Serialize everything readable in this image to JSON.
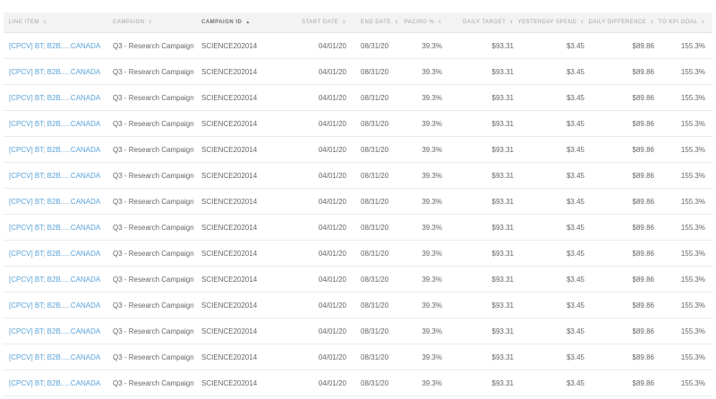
{
  "columns": [
    {
      "label": "Line Item",
      "sort_icon": "sort-icon"
    },
    {
      "label": "Campaign",
      "sort_icon": "sort-icon"
    },
    {
      "label": "Campaign ID",
      "sort_icon": "sort-asc-icon",
      "active": true
    },
    {
      "label": "Start Date",
      "sort_icon": "sort-icon"
    },
    {
      "label": "End Date",
      "sort_icon": "sort-icon"
    },
    {
      "label": "Pacing %",
      "sort_icon": "sort-icon"
    },
    {
      "label": "Daily Target",
      "sort_icon": "sort-icon"
    },
    {
      "label": "Yesterday Spend",
      "sort_icon": "sort-icon"
    },
    {
      "label": "Daily Difference",
      "sort_icon": "sort-icon"
    },
    {
      "label": "To KPI Goal",
      "sort_icon": "sort-icon"
    }
  ],
  "sort_glyphs": {
    "default": "⬍",
    "asc": "▲"
  },
  "colors": {
    "link": "#5aa3d8",
    "header_bg": "#f3f3f3",
    "text": "#666666"
  },
  "rows": [
    {
      "line_item": "[CPCV] BT; B2B.....CANADA",
      "campaign": "Q3 - Research Campaign",
      "campaign_id": "SCIENCE202014",
      "start_date": "04/01/20",
      "end_date": "08/31/20",
      "pacing": "39.3%",
      "daily_target": "$93.31",
      "yesterday_spend": "$3.45",
      "daily_difference": "$89.86",
      "kpi_goal": "155.3%"
    },
    {
      "line_item": "[CPCV] BT; B2B.....CANADA",
      "campaign": "Q3 - Research Campaign",
      "campaign_id": "SCIENCE202014",
      "start_date": "04/01/20",
      "end_date": "08/31/20",
      "pacing": "39.3%",
      "daily_target": "$93.31",
      "yesterday_spend": "$3.45",
      "daily_difference": "$89.86",
      "kpi_goal": "155.3%"
    },
    {
      "line_item": "[CPCV] BT; B2B.....CANADA",
      "campaign": "Q3 - Research Campaign",
      "campaign_id": "SCIENCE202014",
      "start_date": "04/01/20",
      "end_date": "08/31/20",
      "pacing": "39.3%",
      "daily_target": "$93.31",
      "yesterday_spend": "$3.45",
      "daily_difference": "$89.86",
      "kpi_goal": "155.3%"
    },
    {
      "line_item": "[CPCV] BT; B2B.....CANADA",
      "campaign": "Q3 - Research Campaign",
      "campaign_id": "SCIENCE202014",
      "start_date": "04/01/20",
      "end_date": "08/31/20",
      "pacing": "39.3%",
      "daily_target": "$93.31",
      "yesterday_spend": "$3.45",
      "daily_difference": "$89.86",
      "kpi_goal": "155.3%"
    },
    {
      "line_item": "[CPCV] BT; B2B.....CANADA",
      "campaign": "Q3 - Research Campaign",
      "campaign_id": "SCIENCE202014",
      "start_date": "04/01/20",
      "end_date": "08/31/20",
      "pacing": "39.3%",
      "daily_target": "$93.31",
      "yesterday_spend": "$3.45",
      "daily_difference": "$89.86",
      "kpi_goal": "155.3%"
    },
    {
      "line_item": "[CPCV] BT; B2B.....CANADA",
      "campaign": "Q3 - Research Campaign",
      "campaign_id": "SCIENCE202014",
      "start_date": "04/01/20",
      "end_date": "08/31/20",
      "pacing": "39.3%",
      "daily_target": "$93.31",
      "yesterday_spend": "$3.45",
      "daily_difference": "$89.86",
      "kpi_goal": "155.3%"
    },
    {
      "line_item": "[CPCV] BT; B2B.....CANADA",
      "campaign": "Q3 - Research Campaign",
      "campaign_id": "SCIENCE202014",
      "start_date": "04/01/20",
      "end_date": "08/31/20",
      "pacing": "39.3%",
      "daily_target": "$93.31",
      "yesterday_spend": "$3.45",
      "daily_difference": "$89.86",
      "kpi_goal": "155.3%"
    },
    {
      "line_item": "[CPCV] BT; B2B.....CANADA",
      "campaign": "Q3 - Research Campaign",
      "campaign_id": "SCIENCE202014",
      "start_date": "04/01/20",
      "end_date": "08/31/20",
      "pacing": "39.3%",
      "daily_target": "$93.31",
      "yesterday_spend": "$3.45",
      "daily_difference": "$89.86",
      "kpi_goal": "155.3%"
    },
    {
      "line_item": "[CPCV] BT; B2B.....CANADA",
      "campaign": "Q3 - Research Campaign",
      "campaign_id": "SCIENCE202014",
      "start_date": "04/01/20",
      "end_date": "08/31/20",
      "pacing": "39.3%",
      "daily_target": "$93.31",
      "yesterday_spend": "$3.45",
      "daily_difference": "$89.86",
      "kpi_goal": "155.3%"
    },
    {
      "line_item": "[CPCV] BT; B2B.....CANADA",
      "campaign": "Q3 - Research Campaign",
      "campaign_id": "SCIENCE202014",
      "start_date": "04/01/20",
      "end_date": "08/31/20",
      "pacing": "39.3%",
      "daily_target": "$93.31",
      "yesterday_spend": "$3.45",
      "daily_difference": "$89.86",
      "kpi_goal": "155.3%"
    },
    {
      "line_item": "[CPCV] BT; B2B.....CANADA",
      "campaign": "Q3 - Research Campaign",
      "campaign_id": "SCIENCE202014",
      "start_date": "04/01/20",
      "end_date": "08/31/20",
      "pacing": "39.3%",
      "daily_target": "$93.31",
      "yesterday_spend": "$3.45",
      "daily_difference": "$89.86",
      "kpi_goal": "155.3%"
    },
    {
      "line_item": "[CPCV] BT; B2B.....CANADA",
      "campaign": "Q3 - Research Campaign",
      "campaign_id": "SCIENCE202014",
      "start_date": "04/01/20",
      "end_date": "08/31/20",
      "pacing": "39.3%",
      "daily_target": "$93.31",
      "yesterday_spend": "$3.45",
      "daily_difference": "$89.86",
      "kpi_goal": "155.3%"
    },
    {
      "line_item": "[CPCV] BT; B2B.....CANADA",
      "campaign": "Q3 - Research Campaign",
      "campaign_id": "SCIENCE202014",
      "start_date": "04/01/20",
      "end_date": "08/31/20",
      "pacing": "39.3%",
      "daily_target": "$93.31",
      "yesterday_spend": "$3.45",
      "daily_difference": "$89.86",
      "kpi_goal": "155.3%"
    },
    {
      "line_item": "[CPCV] BT; B2B.....CANADA",
      "campaign": "Q3 - Research Campaign",
      "campaign_id": "SCIENCE202014",
      "start_date": "04/01/20",
      "end_date": "08/31/20",
      "pacing": "39.3%",
      "daily_target": "$93.31",
      "yesterday_spend": "$3.45",
      "daily_difference": "$89.86",
      "kpi_goal": "155.3%"
    }
  ]
}
